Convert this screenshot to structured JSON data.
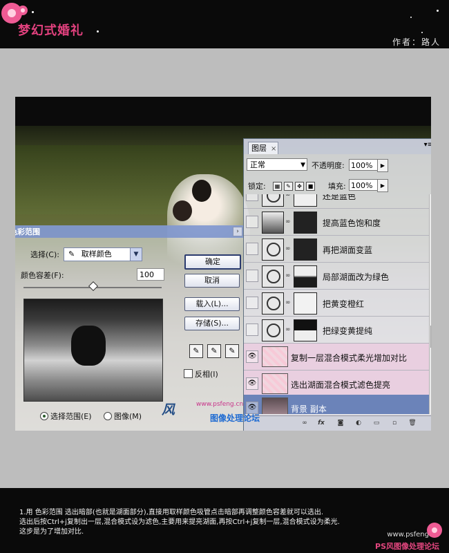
{
  "header": {
    "brand": "梦幻式婚礼",
    "author": "作者：路人"
  },
  "color_range": {
    "title": "色彩范围",
    "select_label": "选择(C):",
    "select_value": "取样颜色",
    "fuzz_label": "颜色容差(F):",
    "fuzz_value": "100",
    "ok": "确定",
    "cancel": "取消",
    "load": "载入(L)...",
    "save": "存储(S)...",
    "invert": "反相(I)",
    "radio_selection": "选择范围(E)",
    "radio_image": "图像(M)"
  },
  "layers": {
    "tab": "图层",
    "tab_close": "×",
    "blend_mode": "正常",
    "opacity_label": "不透明度:",
    "opacity_value": "100%",
    "lock_label": "锁定:",
    "fill_label": "填充:",
    "fill_value": "100%",
    "items": [
      {
        "name": "还是蓝色"
      },
      {
        "name": "提高蓝色饱和度"
      },
      {
        "name": "再把湖面变蓝"
      },
      {
        "name": "局部湖面改为绿色"
      },
      {
        "name": "把黄变橙红"
      },
      {
        "name": "把绿变黄提纯"
      },
      {
        "name": "复制一层混合模式柔光增加对比"
      },
      {
        "name": "选出湖面混合模式滤色提亮"
      },
      {
        "name": "背景 副本"
      }
    ]
  },
  "watermark": {
    "site": "www.psfeng.cn",
    "forum": "图像处理论坛",
    "logo": "风"
  },
  "footer": {
    "line1": "1.用 色彩范围 选出暗部(也就是湖面部分),直接用取样颜色吸管点击暗部再调整颜色容差就可以选出.",
    "line2": "选出后按Ctrl+j复制出一层,混合模式设为滤色,主要用来提亮湖面,再按Ctrl+j复制一层,混合模式设为柔光.",
    "line3": "这步是为了增加对比.",
    "site": "www.psfeng.cn",
    "forum": "PS风图像处理论坛"
  }
}
